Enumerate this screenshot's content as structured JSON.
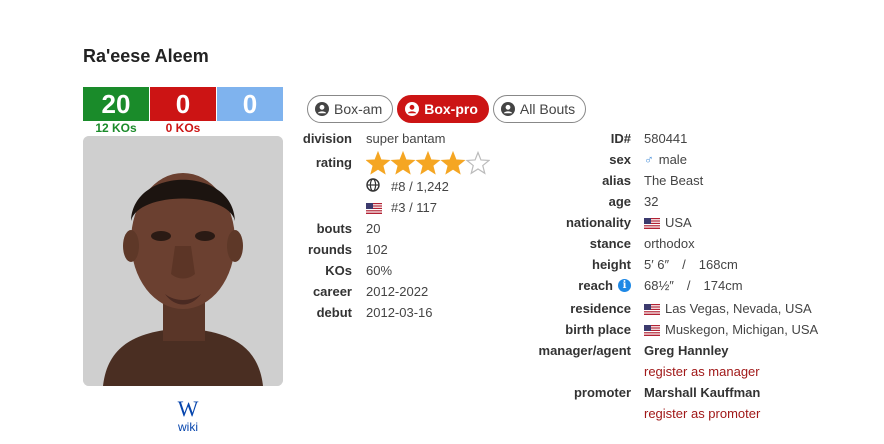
{
  "boxer": {
    "name": "Ra'eese Aleem",
    "record": {
      "wins": "20",
      "losses": "0",
      "draws": "0",
      "wins_kos": "12 KOs",
      "losses_kos": "0 KOs"
    }
  },
  "wiki_label": "wiki",
  "wiki_glyph": "W",
  "tabs": [
    {
      "label": "Box-am",
      "active": false
    },
    {
      "label": "Box-pro",
      "active": true
    },
    {
      "label": "All Bouts",
      "active": false
    }
  ],
  "left": {
    "division_label": "division",
    "division": "super bantam",
    "rating_label": "rating",
    "rating_stars": 4,
    "rating_max": 5,
    "world_rank": "#8 / 1,242",
    "country_rank": "#3 / 117",
    "bouts_label": "bouts",
    "bouts": "20",
    "rounds_label": "rounds",
    "rounds": "102",
    "kos_label": "KOs",
    "kos": "60%",
    "career_label": "career",
    "career": "2012-2022",
    "debut_label": "debut",
    "debut": "2012-03-16"
  },
  "right": {
    "id_label": "ID#",
    "id": "580441",
    "sex_label": "sex",
    "sex": "male",
    "alias_label": "alias",
    "alias": "The Beast",
    "age_label": "age",
    "age": "32",
    "nationality_label": "nationality",
    "nationality": "USA",
    "stance_label": "stance",
    "stance": "orthodox",
    "height_label": "height",
    "height_imperial": "5′ 6″",
    "height_sep": "/",
    "height_metric": "168cm",
    "reach_label": "reach",
    "reach_imperial": "68½″",
    "reach_sep": "/",
    "reach_metric": "174cm",
    "residence_label": "residence",
    "residence": "Las Vegas, Nevada, USA",
    "birthplace_label": "birth place",
    "birthplace": "Muskegon, Michigan, USA",
    "manager_label": "manager/agent",
    "manager": "Greg Hannley",
    "register_manager": "register as manager",
    "promoter_label": "promoter",
    "promoter": "Marshall Kauffman",
    "register_promoter": "register as promoter"
  },
  "colors": {
    "win": "#1a8b2a",
    "loss": "#cc1414",
    "draw": "#7fb3ee",
    "star": "#f5a623",
    "link": "#a01818"
  }
}
